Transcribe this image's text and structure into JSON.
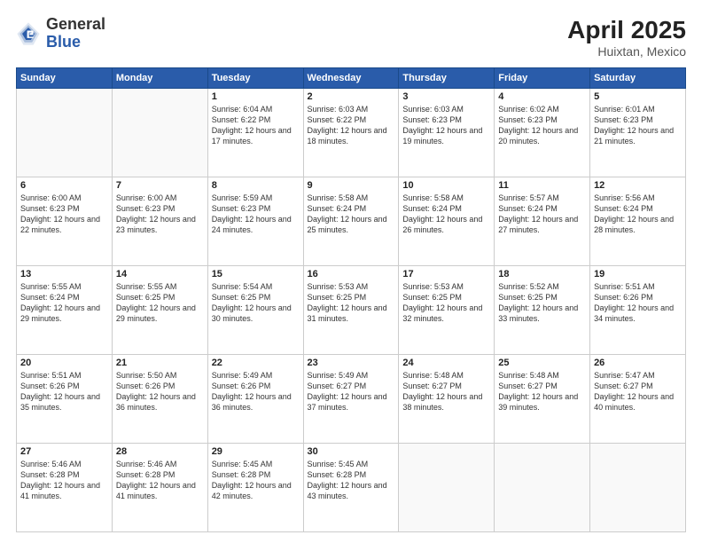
{
  "header": {
    "logo_general": "General",
    "logo_blue": "Blue",
    "month_year": "April 2025",
    "location": "Huixtan, Mexico"
  },
  "weekdays": [
    "Sunday",
    "Monday",
    "Tuesday",
    "Wednesday",
    "Thursday",
    "Friday",
    "Saturday"
  ],
  "weeks": [
    [
      {
        "day": "",
        "info": ""
      },
      {
        "day": "",
        "info": ""
      },
      {
        "day": "1",
        "info": "Sunrise: 6:04 AM\nSunset: 6:22 PM\nDaylight: 12 hours and 17 minutes."
      },
      {
        "day": "2",
        "info": "Sunrise: 6:03 AM\nSunset: 6:22 PM\nDaylight: 12 hours and 18 minutes."
      },
      {
        "day": "3",
        "info": "Sunrise: 6:03 AM\nSunset: 6:23 PM\nDaylight: 12 hours and 19 minutes."
      },
      {
        "day": "4",
        "info": "Sunrise: 6:02 AM\nSunset: 6:23 PM\nDaylight: 12 hours and 20 minutes."
      },
      {
        "day": "5",
        "info": "Sunrise: 6:01 AM\nSunset: 6:23 PM\nDaylight: 12 hours and 21 minutes."
      }
    ],
    [
      {
        "day": "6",
        "info": "Sunrise: 6:00 AM\nSunset: 6:23 PM\nDaylight: 12 hours and 22 minutes."
      },
      {
        "day": "7",
        "info": "Sunrise: 6:00 AM\nSunset: 6:23 PM\nDaylight: 12 hours and 23 minutes."
      },
      {
        "day": "8",
        "info": "Sunrise: 5:59 AM\nSunset: 6:23 PM\nDaylight: 12 hours and 24 minutes."
      },
      {
        "day": "9",
        "info": "Sunrise: 5:58 AM\nSunset: 6:24 PM\nDaylight: 12 hours and 25 minutes."
      },
      {
        "day": "10",
        "info": "Sunrise: 5:58 AM\nSunset: 6:24 PM\nDaylight: 12 hours and 26 minutes."
      },
      {
        "day": "11",
        "info": "Sunrise: 5:57 AM\nSunset: 6:24 PM\nDaylight: 12 hours and 27 minutes."
      },
      {
        "day": "12",
        "info": "Sunrise: 5:56 AM\nSunset: 6:24 PM\nDaylight: 12 hours and 28 minutes."
      }
    ],
    [
      {
        "day": "13",
        "info": "Sunrise: 5:55 AM\nSunset: 6:24 PM\nDaylight: 12 hours and 29 minutes."
      },
      {
        "day": "14",
        "info": "Sunrise: 5:55 AM\nSunset: 6:25 PM\nDaylight: 12 hours and 29 minutes."
      },
      {
        "day": "15",
        "info": "Sunrise: 5:54 AM\nSunset: 6:25 PM\nDaylight: 12 hours and 30 minutes."
      },
      {
        "day": "16",
        "info": "Sunrise: 5:53 AM\nSunset: 6:25 PM\nDaylight: 12 hours and 31 minutes."
      },
      {
        "day": "17",
        "info": "Sunrise: 5:53 AM\nSunset: 6:25 PM\nDaylight: 12 hours and 32 minutes."
      },
      {
        "day": "18",
        "info": "Sunrise: 5:52 AM\nSunset: 6:25 PM\nDaylight: 12 hours and 33 minutes."
      },
      {
        "day": "19",
        "info": "Sunrise: 5:51 AM\nSunset: 6:26 PM\nDaylight: 12 hours and 34 minutes."
      }
    ],
    [
      {
        "day": "20",
        "info": "Sunrise: 5:51 AM\nSunset: 6:26 PM\nDaylight: 12 hours and 35 minutes."
      },
      {
        "day": "21",
        "info": "Sunrise: 5:50 AM\nSunset: 6:26 PM\nDaylight: 12 hours and 36 minutes."
      },
      {
        "day": "22",
        "info": "Sunrise: 5:49 AM\nSunset: 6:26 PM\nDaylight: 12 hours and 36 minutes."
      },
      {
        "day": "23",
        "info": "Sunrise: 5:49 AM\nSunset: 6:27 PM\nDaylight: 12 hours and 37 minutes."
      },
      {
        "day": "24",
        "info": "Sunrise: 5:48 AM\nSunset: 6:27 PM\nDaylight: 12 hours and 38 minutes."
      },
      {
        "day": "25",
        "info": "Sunrise: 5:48 AM\nSunset: 6:27 PM\nDaylight: 12 hours and 39 minutes."
      },
      {
        "day": "26",
        "info": "Sunrise: 5:47 AM\nSunset: 6:27 PM\nDaylight: 12 hours and 40 minutes."
      }
    ],
    [
      {
        "day": "27",
        "info": "Sunrise: 5:46 AM\nSunset: 6:28 PM\nDaylight: 12 hours and 41 minutes."
      },
      {
        "day": "28",
        "info": "Sunrise: 5:46 AM\nSunset: 6:28 PM\nDaylight: 12 hours and 41 minutes."
      },
      {
        "day": "29",
        "info": "Sunrise: 5:45 AM\nSunset: 6:28 PM\nDaylight: 12 hours and 42 minutes."
      },
      {
        "day": "30",
        "info": "Sunrise: 5:45 AM\nSunset: 6:28 PM\nDaylight: 12 hours and 43 minutes."
      },
      {
        "day": "",
        "info": ""
      },
      {
        "day": "",
        "info": ""
      },
      {
        "day": "",
        "info": ""
      }
    ]
  ]
}
